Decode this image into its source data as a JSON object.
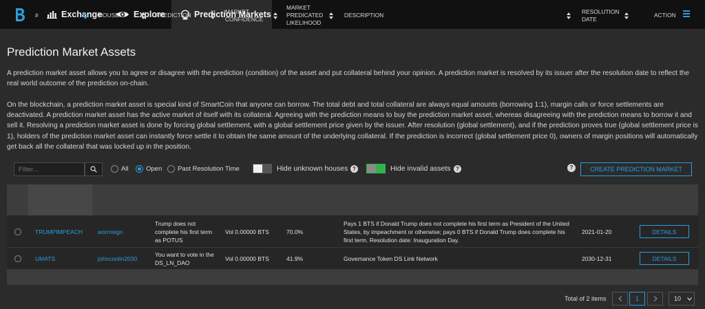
{
  "nav": {
    "tabs": [
      {
        "label": "Exchange",
        "icon": "bar-chart-icon"
      },
      {
        "label": "Explore",
        "icon": "eye-icon"
      },
      {
        "label": "Prediction Markets",
        "icon": "crystal-ball-icon",
        "active": true
      }
    ],
    "menu_icon": "hamburger-menu-icon"
  },
  "page": {
    "title": "Prediction Market Assets",
    "intro": "A prediction market asset allows you to agree or disagree with the prediction (condition) of the asset and put collateral behind your opinion. A prediction market is resolved by its issuer after the resolution date to reflect the real world outcome of the prediction on-chain.",
    "details": "On the blockchain, a prediction market asset is special kind of SmartCoin that anyone can borrow. The total debt and total collateral are always equal amounts (borrowing 1:1), margin calls or force settlements are deactivated. A prediction market asset has the active market of itself with its collateral. Agreeing with the prediction means to buy the prediction market asset, whereas disagreeing with the prediction means to borrow it and sell it. Resolving a prediction market asset is done by forcing global settlement, with a global settlement price given by the issuer. After resolution (global settlement), and if the prediction proves true (global settlement price is 1), holders of the prediction market asset can instantly force settle it to obtain the same amount of the underlying collateral. If the prediction is incorrect (global settlement price 0), owners of margin positions will automatically get back all the collateral that was locked up in the position."
  },
  "filters": {
    "search_placeholder": "Filter...",
    "radios": [
      {
        "label": "All",
        "selected": false
      },
      {
        "label": "Open",
        "selected": true
      },
      {
        "label": "Past Resolution Time",
        "selected": false
      }
    ],
    "hide_unknown_houses": {
      "label": "Hide unknown houses",
      "on": false
    },
    "hide_invalid_assets": {
      "label": "Hide invalid assets",
      "on": true
    },
    "create_button": "CREATE PREDICTION MARKET"
  },
  "table": {
    "headers": {
      "id": "#",
      "house": "HOUSE",
      "prediction": "PREDICTION",
      "confidence_1": "MARKET",
      "confidence_2": "CONFIDENCE",
      "likelihood_1": "MARKET",
      "likelihood_2": "PREDICATED",
      "likelihood_3": "LIKELIHOOD",
      "description": "DESCRIPTION",
      "resolution_1": "RESOLUTION",
      "resolution_2": "DATE",
      "action": "ACTION"
    },
    "rows": [
      {
        "id": "TRUMPIMPEACH",
        "house": "wormsign",
        "prediction": "Trump does not complete his first term as POTUS",
        "confidence": "Vol 0.00000 BTS",
        "likelihood": "70.0%",
        "description": "Pays 1 BTS if Donald Trump does not complete his first term as President of the United States, by impeachment or otherwise; pays 0 BTS if Donald Trump does complete his first term. Resolution date: Inauguration Day.",
        "resolution_date": "2021-01-20",
        "action": "DETAILS"
      },
      {
        "id": "UMATS",
        "house": "johnconlin2030",
        "prediction": "You want to vote in the DS_LN_DAO",
        "confidence": "Vol 0.00000 BTS",
        "likelihood": "41.9%",
        "description": "Governance Token DS Link Network",
        "resolution_date": "2030-12-31",
        "action": "DETAILS"
      }
    ]
  },
  "pagination": {
    "total": "Total of 2 items",
    "current_page": "1",
    "page_size": "10"
  },
  "colors": {
    "accent": "#2a9ee0",
    "toggle_on": "#2fb34b",
    "background": "#2b2b2b",
    "topbar": "#111111"
  }
}
